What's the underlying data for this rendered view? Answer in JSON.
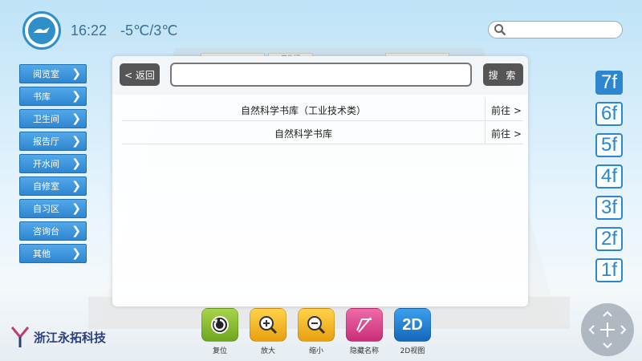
{
  "header": {
    "time": "16:22",
    "weather": "-5℃/3℃"
  },
  "sidebar": {
    "items": [
      {
        "label": "阅览室"
      },
      {
        "label": "书库"
      },
      {
        "label": "卫生间"
      },
      {
        "label": "报告厅"
      },
      {
        "label": "开水间"
      },
      {
        "label": "自修室"
      },
      {
        "label": "自习区"
      },
      {
        "label": "咨询台"
      },
      {
        "label": "其他"
      }
    ]
  },
  "panel": {
    "back_label": "< 返回",
    "search_value": "",
    "search_label": "搜 索",
    "results": [
      {
        "name": "自然科学书库（工业技术类）",
        "action": "前往 >"
      },
      {
        "name": "自然科学书库",
        "action": "前往 >"
      }
    ]
  },
  "floors": [
    "7f",
    "6f",
    "5f",
    "4f",
    "3f",
    "2f",
    "1f"
  ],
  "active_floor": "7f",
  "toolbar": {
    "reset": "复位",
    "zoom_in": "放大",
    "zoom_out": "缩小",
    "hide_names": "隐藏名称",
    "view_2d": "2D视图",
    "view_2d_icon_text": "2D"
  },
  "bg_room_label": "卫生间",
  "brand": {
    "name": "浙江永拓科技"
  },
  "colors": {
    "accent": "#2d86d0",
    "reset_icon": "#7fb82a",
    "zoom_icon": "#f2b01e",
    "hide_icon": "#d93f8b",
    "view2d_icon": "#1e7fcf"
  }
}
